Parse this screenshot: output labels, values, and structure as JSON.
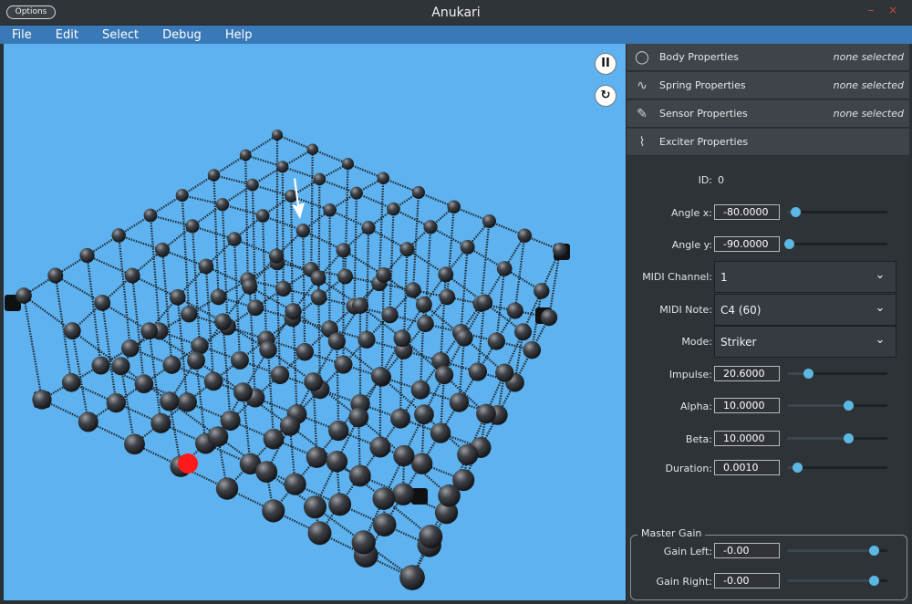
{
  "window": {
    "title": "Anukari",
    "options_label": "Options",
    "minimize_glyph": "–",
    "close_glyph": "×"
  },
  "menu": {
    "items": [
      "File",
      "Edit",
      "Select",
      "Debug",
      "Help"
    ]
  },
  "viewport": {
    "pause_glyph": "II",
    "reset_glyph": "↻",
    "background_color": "#5db2ef",
    "highlight_color": "#ff1a1a"
  },
  "sections": [
    {
      "icon": "body-icon",
      "title": "Body Properties",
      "status": "none selected"
    },
    {
      "icon": "spring-icon",
      "title": "Spring Properties",
      "status": "none selected"
    },
    {
      "icon": "sensor-icon",
      "title": "Sensor Properties",
      "status": "none selected"
    },
    {
      "icon": "exciter-icon",
      "title": "Exciter Properties",
      "status": ""
    }
  ],
  "exciter": {
    "id_label": "ID:",
    "id_value": "0",
    "angle_x": {
      "label": "Angle x:",
      "value": "-80.0000",
      "level": 0.08
    },
    "angle_y": {
      "label": "Angle y:",
      "value": "-90.0000",
      "level": 0.02
    },
    "midi_channel": {
      "label": "MIDI Channel:",
      "value": "1"
    },
    "midi_note": {
      "label": "MIDI Note:",
      "value": "C4 (60)"
    },
    "mode": {
      "label": "Mode:",
      "value": "Striker"
    },
    "impulse": {
      "label": "Impulse:",
      "value": "20.6000",
      "level": 0.21
    },
    "alpha": {
      "label": "Alpha:",
      "value": "10.0000",
      "level": 0.61
    },
    "beta": {
      "label": "Beta:",
      "value": "10.0000",
      "level": 0.61
    },
    "duration": {
      "label": "Duration:",
      "value": "0.0010",
      "level": 0.1
    }
  },
  "master_gain": {
    "title": "Master Gain",
    "gain_left": {
      "label": "Gain Left:",
      "value": "-0.00",
      "level": 0.86
    },
    "gain_right": {
      "label": "Gain Right:",
      "value": "-0.00",
      "level": 0.86
    }
  },
  "colors": {
    "accent": "#5ab8e2",
    "menubar": "#3a79b7",
    "panel": "#2e3338"
  }
}
